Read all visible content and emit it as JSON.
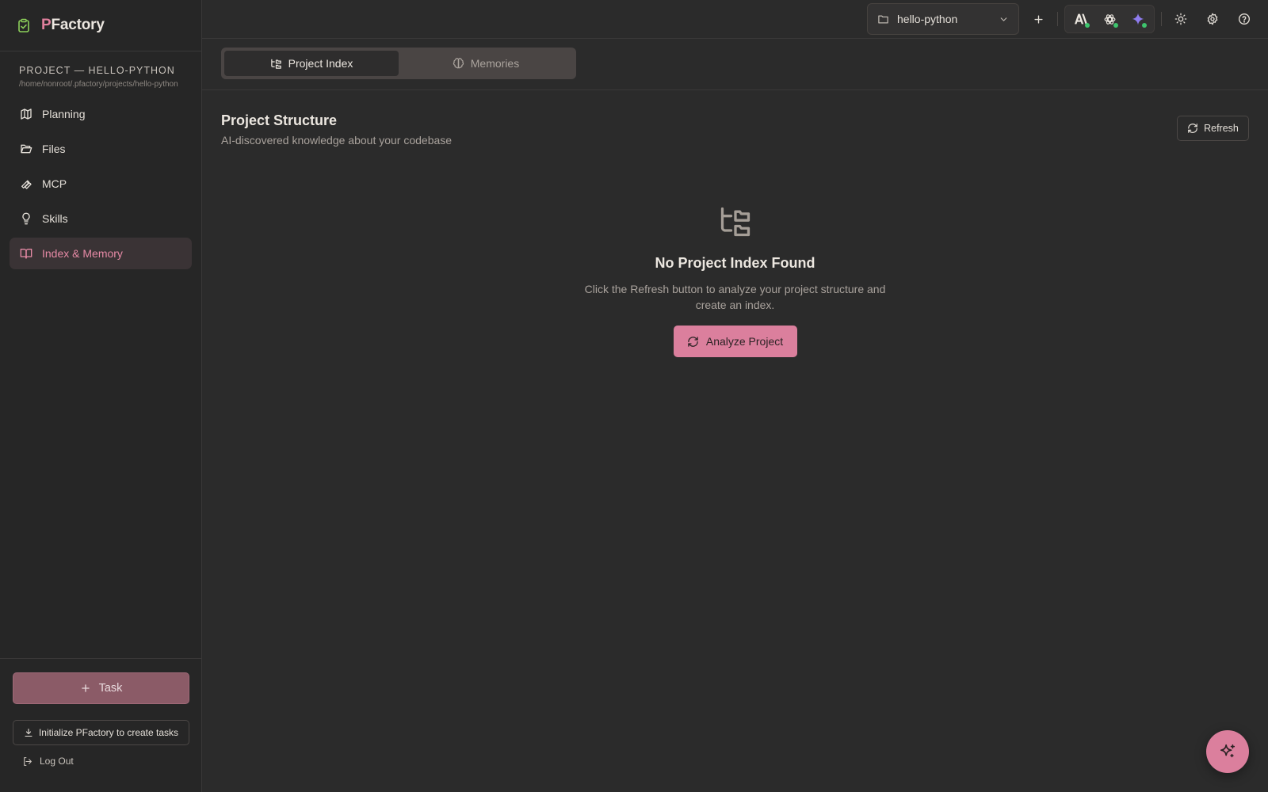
{
  "brand": {
    "initial": "P",
    "rest": "Factory",
    "icon": "clipboard-check-icon"
  },
  "project": {
    "label": "PROJECT — HELLO-PYTHON",
    "path": "/home/nonroot/.pfactory/projects/hello-python"
  },
  "nav": {
    "items": [
      {
        "label": "Planning",
        "icon": "map-icon"
      },
      {
        "label": "Files",
        "icon": "folder-open-icon"
      },
      {
        "label": "MCP",
        "icon": "wrench-icon"
      },
      {
        "label": "Skills",
        "icon": "lightbulb-icon"
      },
      {
        "label": "Index & Memory",
        "icon": "book-open-icon",
        "active": true
      }
    ]
  },
  "sidebar_bottom": {
    "task_label": "Task",
    "init_label": "Initialize PFactory to create tasks",
    "logout_label": "Log Out"
  },
  "topbar": {
    "project_select": "hello-python",
    "icons": [
      "folder-icon",
      "chevron-down-icon",
      "plus-icon",
      "anthropic-icon",
      "openai-icon",
      "gemini-icon",
      "sun-icon",
      "gear-icon",
      "help-icon"
    ]
  },
  "tabs": [
    {
      "label": "Project Index",
      "icon": "folder-tree-icon",
      "active": true
    },
    {
      "label": "Memories",
      "icon": "brain-icon",
      "active": false
    }
  ],
  "section": {
    "title": "Project Structure",
    "subtitle": "AI-discovered knowledge about your codebase",
    "refresh_label": "Refresh"
  },
  "empty_state": {
    "title": "No Project Index Found",
    "description": "Click the Refresh button to analyze your project structure and create an index.",
    "button_label": "Analyze Project"
  },
  "colors": {
    "accent": "#db7f9d",
    "background": "#2b2b2b",
    "sidebar": "#262626",
    "status_online": "#3ec46d"
  }
}
